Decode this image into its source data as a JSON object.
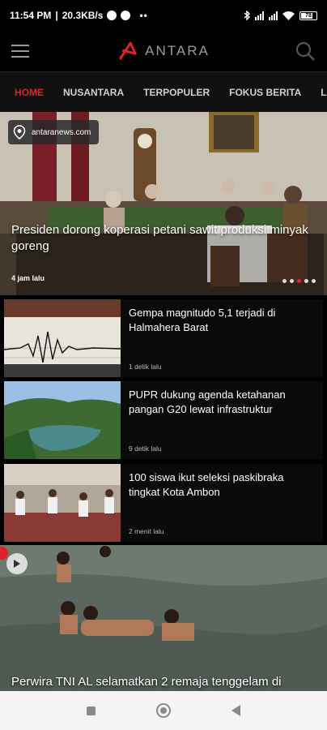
{
  "status_bar": {
    "time": "11:54 PM",
    "network_speed": "20.3KB/s",
    "more": "••",
    "battery": "78",
    "icons": [
      "whatsapp-icon",
      "messenger-icon",
      "bluetooth-icon",
      "signal-icon",
      "wifi-icon",
      "battery-icon"
    ]
  },
  "header": {
    "logo_text": "ANTARA",
    "menu_icon": "menu-icon",
    "search_icon": "search-icon",
    "brand_color": "#e0202a"
  },
  "tabs": [
    {
      "label": "HOME",
      "active": true
    },
    {
      "label": "NUSANTARA",
      "active": false
    },
    {
      "label": "TERPOPULER",
      "active": false
    },
    {
      "label": "FOKUS BERITA",
      "active": false
    },
    {
      "label": "LI",
      "active": false
    }
  ],
  "hero": {
    "source": "antaranews.com",
    "title": "Presiden dorong koperasi petani sawit produksi minyak goreng",
    "time": "4 jam lalu",
    "pager_count": 5,
    "pager_active": 3
  },
  "news": [
    {
      "title": "Gempa magnitudo 5,1 terjadi di Halmahera Barat",
      "time": "1 detik lalu"
    },
    {
      "title": "PUPR dukung agenda ketahanan pangan G20 lewat infrastruktur",
      "time": "9 detik lalu"
    },
    {
      "title": "100 siswa ikut seleksi paskibraka tingkat Kota Ambon",
      "time": "2 menit lalu"
    }
  ],
  "video": {
    "title": "Perwira TNI AL selamatkan 2 remaja tenggelam di"
  },
  "nav": {
    "recents": "recents-icon",
    "home": "home-icon",
    "back": "back-icon"
  }
}
